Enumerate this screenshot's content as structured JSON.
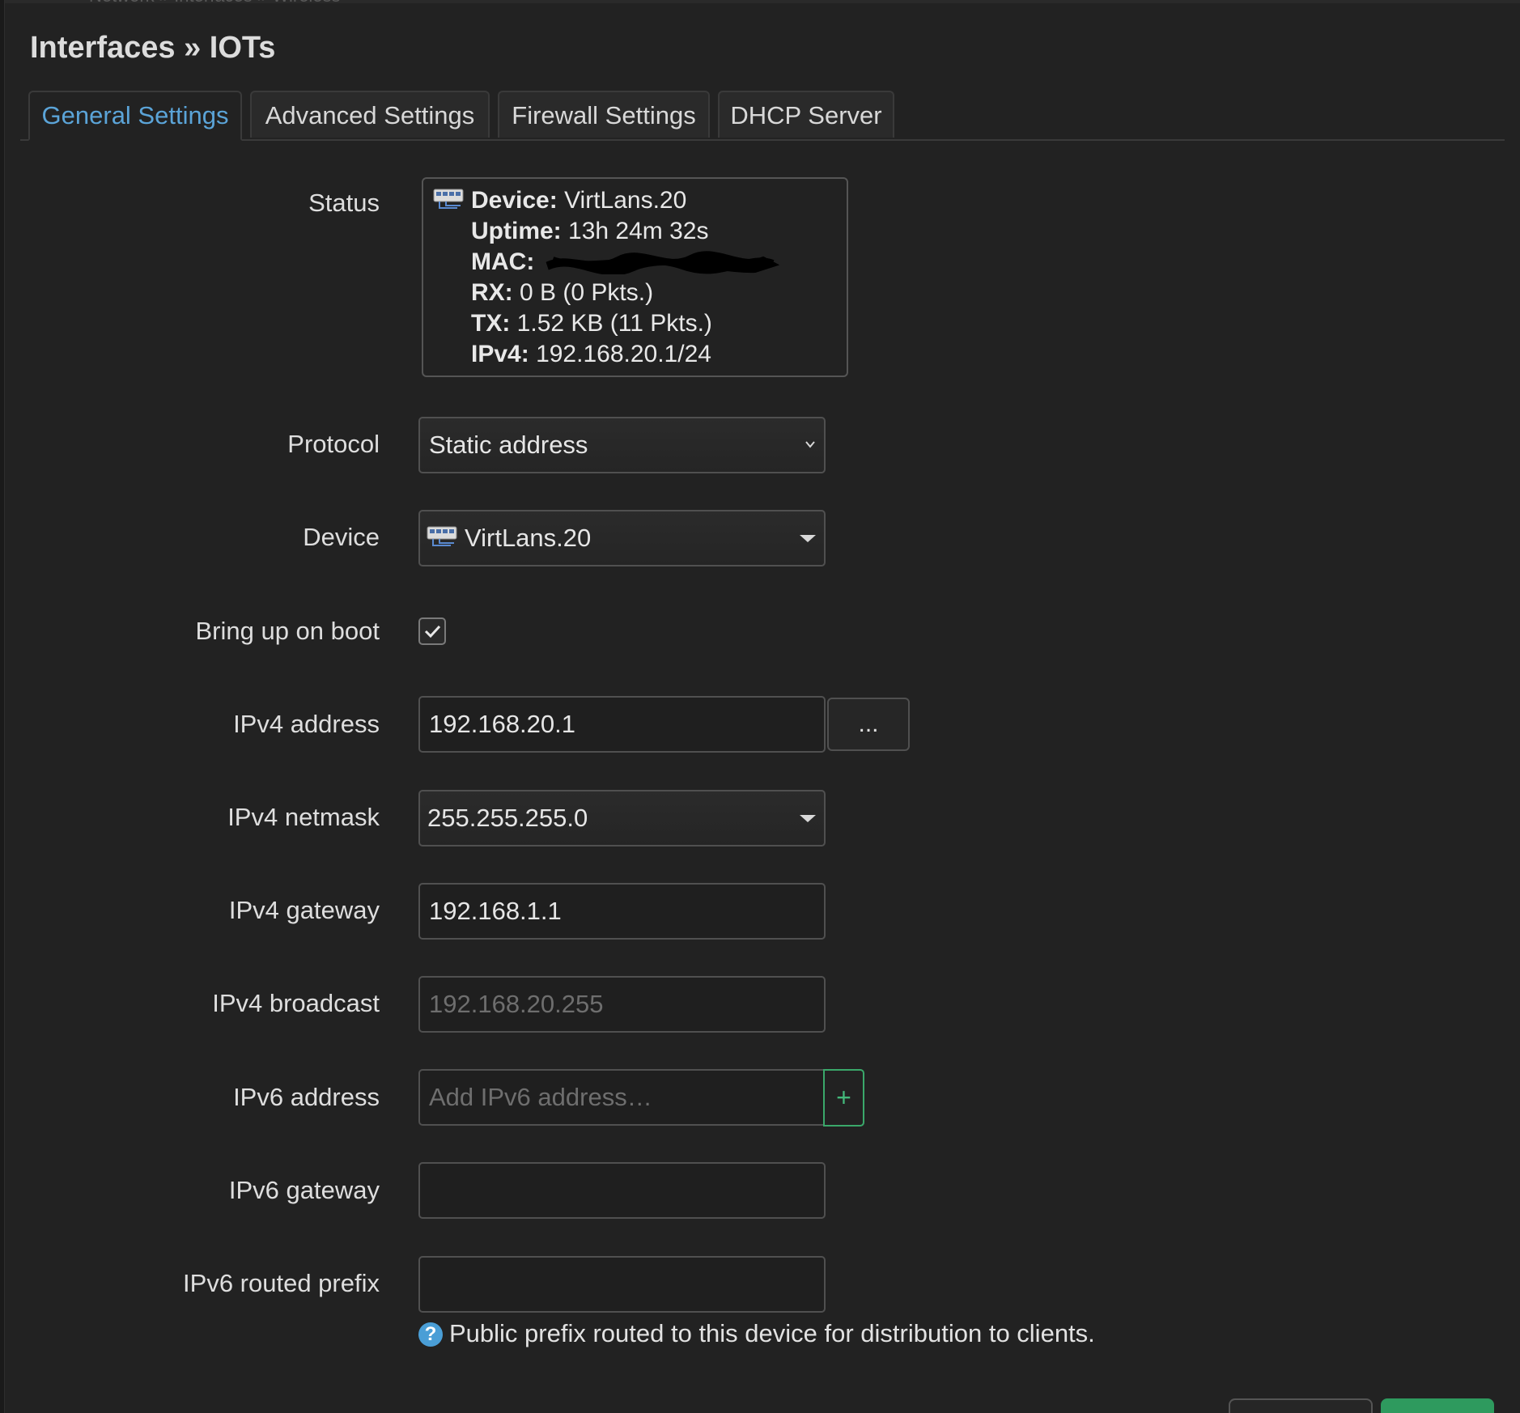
{
  "header": {
    "cutoff_text": "Network  »  Interfaces  »  Wireless",
    "title": "Interfaces » IOTs"
  },
  "tabs": [
    {
      "label": "General Settings",
      "active": true
    },
    {
      "label": "Advanced Settings",
      "active": false
    },
    {
      "label": "Firewall Settings",
      "active": false
    },
    {
      "label": "DHCP Server",
      "active": false
    }
  ],
  "labels": {
    "status": "Status",
    "protocol": "Protocol",
    "device": "Device",
    "bring_up_on_boot": "Bring up on boot",
    "ipv4_address": "IPv4 address",
    "ipv4_netmask": "IPv4 netmask",
    "ipv4_gateway": "IPv4 gateway",
    "ipv4_broadcast": "IPv4 broadcast",
    "ipv6_address": "IPv6 address",
    "ipv6_gateway": "IPv6 gateway",
    "ipv6_routed_prefix": "IPv6 routed prefix"
  },
  "status": {
    "device_key": "Device:",
    "device_val": "VirtLans.20",
    "uptime_key": "Uptime:",
    "uptime_val": "13h 24m 32s",
    "mac_key": "MAC:",
    "rx_key": "RX:",
    "rx_val": "0 B (0 Pkts.)",
    "tx_key": "TX:",
    "tx_val": "1.52 KB (11 Pkts.)",
    "ipv4_key": "IPv4:",
    "ipv4_val": "192.168.20.1/24"
  },
  "fields": {
    "protocol": "Static address",
    "device": "VirtLans.20",
    "bring_up_on_boot": true,
    "ipv4_address": "192.168.20.1",
    "ipv4_address_more": "...",
    "ipv4_netmask": "255.255.255.0",
    "ipv4_gateway": "192.168.1.1",
    "ipv4_broadcast_placeholder": "192.168.20.255",
    "ipv6_address_placeholder": "Add IPv6 address…",
    "ipv6_add": "+",
    "ipv6_gateway": "",
    "ipv6_routed_prefix": ""
  },
  "help": {
    "icon": "?",
    "ipv6_routed_prefix": "Public prefix routed to this device for distribution to clients."
  },
  "colors": {
    "accent_blue": "#5ba4d8",
    "add_green": "#43b87a",
    "background": "#222222"
  },
  "icons": [
    "network-device-icon",
    "chevron-down-icon",
    "caret-down-icon",
    "checkmark-icon",
    "help-icon",
    "plus-icon"
  ]
}
